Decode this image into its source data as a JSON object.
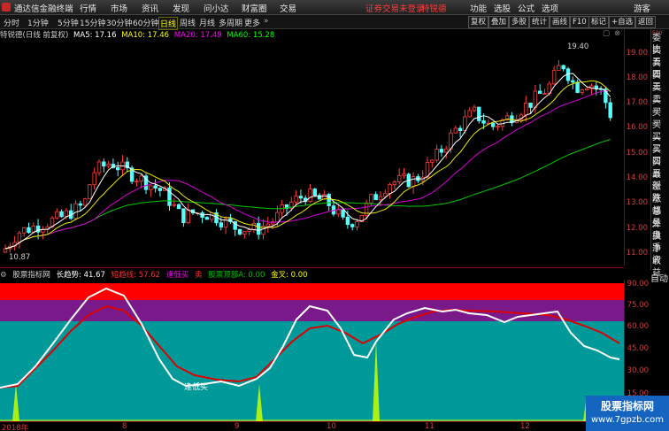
{
  "app": {
    "title": "通达信金融终端",
    "menu": [
      "行情",
      "市场",
      "资讯",
      "发现",
      "问小达",
      "财富圈",
      "交易"
    ],
    "alert": "证券交易未登录",
    "stock_link": "特锐德",
    "right_menu": [
      "功能",
      "选股",
      "公式",
      "选项",
      "游客"
    ]
  },
  "toolbar": {
    "periods": [
      "分时",
      "1分钟",
      "5分钟",
      "15分钟",
      "30分钟",
      "60分钟",
      "日线",
      "周线",
      "月线",
      "多周期",
      "更多"
    ],
    "active_period": "日线",
    "right_buttons": [
      "复权",
      "叠加",
      "多股",
      "统计",
      "画线",
      "F10",
      "标记",
      "+自选",
      "返回"
    ]
  },
  "info": {
    "stock": "特锐德(日线 前复权)",
    "ma5": "MA5: 17.16",
    "ma10": "MA10: 17.46",
    "ma20": "MA20: 17.49",
    "ma60": "MA60: 15.28"
  },
  "colors": {
    "ma5": "#ffffff",
    "ma10": "#ffff00",
    "ma20": "#ff00ff",
    "ma60": "#00ff00",
    "up": "#ff3c3c",
    "down": "#54ffff",
    "axis": "#d43c3c"
  },
  "price_axis": [
    "19.00",
    "18.00",
    "17.00",
    "16.00",
    "15.00",
    "14.00",
    "13.00",
    "12.00",
    "11.00"
  ],
  "price_marks": {
    "high": "19.40",
    "low": "10.87"
  },
  "side_panel": [
    "委比",
    "卖五",
    "卖四",
    "卖三",
    "卖二",
    "卖一",
    "买一",
    "买二",
    "买三",
    "买四",
    "买五",
    "最新",
    "涨跌",
    "涨幅",
    "总量",
    "外盘",
    "换手",
    "净资",
    "收益"
  ],
  "side_panel_top": "500",
  "auto_label": "自动",
  "indicator": {
    "name": "股票指标网",
    "long_trend": "长趋势: 41.67",
    "short_trend": "短趋线: 57.62",
    "buy_low": "逢低买",
    "sell": "卖",
    "top_label": "股票顶部A: 0.00",
    "golden_cross": "金叉: 0.00",
    "chart_label": "逢低买",
    "axis": [
      "90.00",
      "75.00",
      "60.00",
      "45.00",
      "30.00",
      "15.00"
    ]
  },
  "date_axis": [
    "2018年",
    "8",
    "9",
    "10",
    "11",
    "12"
  ],
  "watermark": {
    "title": "股票指标网",
    "url": "www.7gpzb.com"
  }
}
